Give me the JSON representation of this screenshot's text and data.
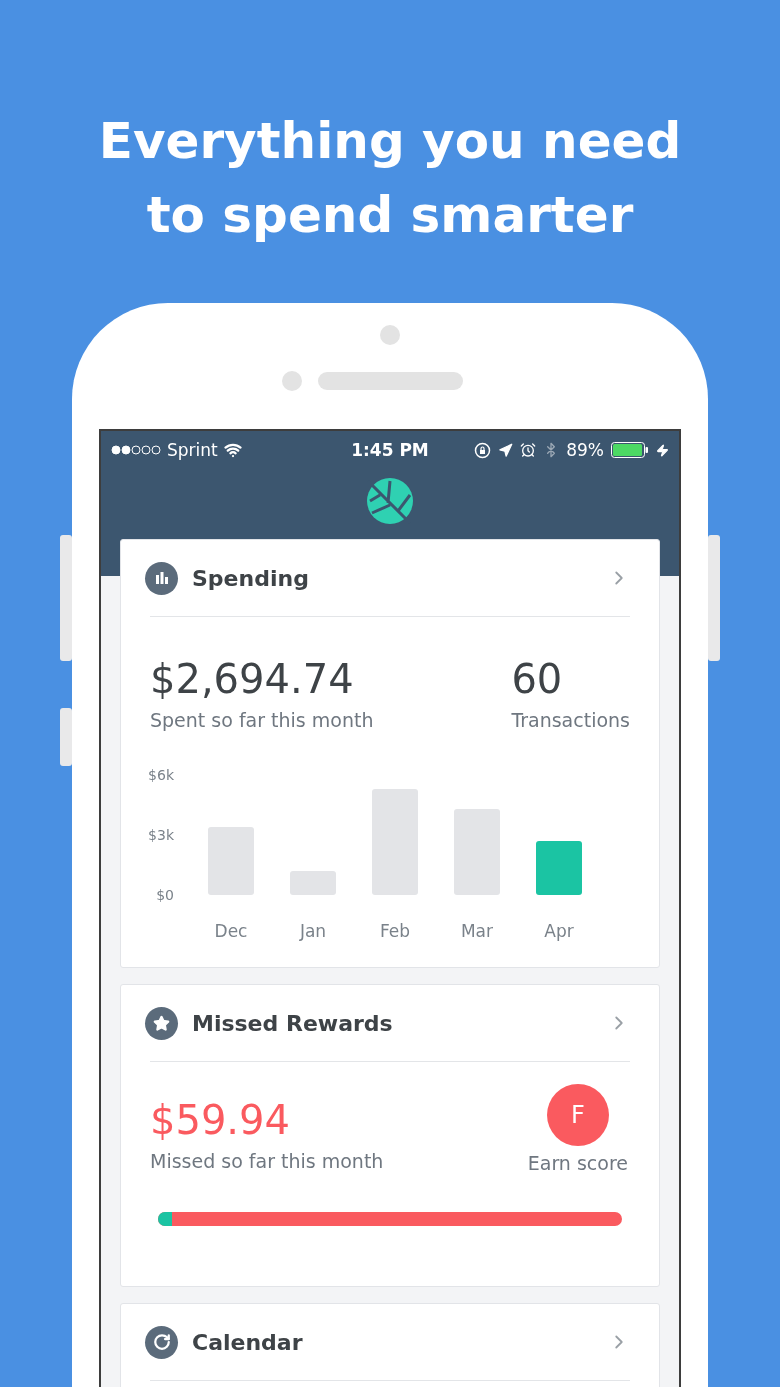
{
  "headline": [
    "Everything you need",
    "to spend smarter"
  ],
  "status_bar": {
    "carrier": "Sprint",
    "time": "1:45 PM",
    "battery": "89%"
  },
  "cards": [
    {
      "kind": "spending",
      "title": "Spending",
      "amount": "$2,694.74",
      "amount_label": "Spent so far this month",
      "count": "60",
      "count_label": "Transactions",
      "chart_data": {
        "type": "bar",
        "categories": [
          "Dec",
          "Jan",
          "Feb",
          "Mar",
          "Apr"
        ],
        "ylim": [
          0,
          6000
        ],
        "yticks": [
          {
            "value": 0,
            "label": "$0"
          },
          {
            "value": 3000,
            "label": "$3k"
          },
          {
            "value": 6000,
            "label": "$6k"
          }
        ],
        "series": [
          {
            "color": "#e3e4e7",
            "values": [
              3400,
              1200,
              5300,
              4300,
              null
            ]
          },
          {
            "color": "#1bc4a3",
            "values": [
              null,
              null,
              null,
              null,
              2700
            ]
          }
        ]
      }
    },
    {
      "kind": "rewards",
      "title": "Missed Rewards",
      "amount": "$59.94",
      "amount_label": "Missed so far this month",
      "grade": "F",
      "grade_label": "Earn score",
      "level": 0.03
    },
    {
      "kind": "calendar",
      "title": "Calendar"
    }
  ]
}
